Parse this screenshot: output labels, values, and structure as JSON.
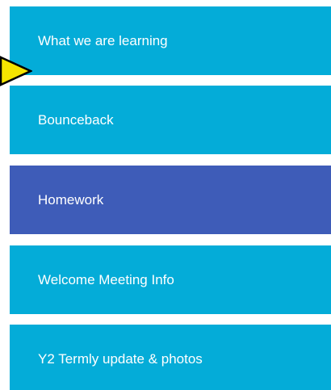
{
  "menu": {
    "items": [
      {
        "label": "What we are learning",
        "active": false
      },
      {
        "label": "Bounceback",
        "active": false
      },
      {
        "label": "Homework",
        "active": true
      },
      {
        "label": "Welcome Meeting Info",
        "active": false
      },
      {
        "label": "Y2 Termly update & photos",
        "active": false
      }
    ]
  },
  "colors": {
    "item_background": "#04acd8",
    "active_background": "#3e5cb8",
    "label_text": "#ffffff",
    "pointer_fill": "#f5e400",
    "pointer_outline": "#000000"
  },
  "icons": {
    "pointer": "arrow-pointer-icon"
  }
}
